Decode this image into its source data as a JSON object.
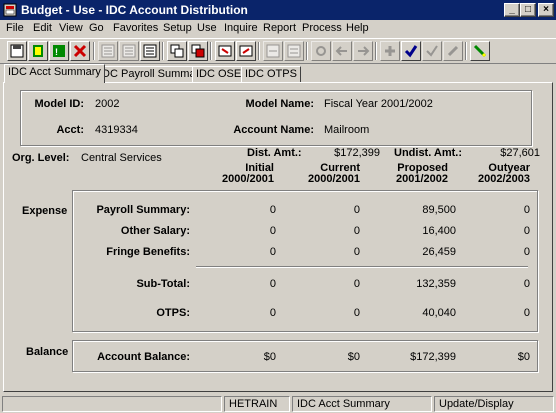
{
  "window": {
    "title": "Budget - Use - IDC Account Distribution"
  },
  "menu": [
    "File",
    "Edit",
    "View",
    "Go",
    "Favorites",
    "Setup",
    "Use",
    "Inquire",
    "Report",
    "Process",
    "Help"
  ],
  "tabs": [
    "IDC Acct Summary",
    "IDC Payroll Summary",
    "IDC OSE",
    "IDC OTPS"
  ],
  "header": {
    "model_id_label": "Model ID:",
    "model_id": "2002",
    "model_name_label": "Model Name:",
    "model_name": "Fiscal Year 2001/2002",
    "acct_label": "Acct:",
    "acct": "4319334",
    "account_name_label": "Account Name:",
    "account_name": "Mailroom"
  },
  "org": {
    "org_level_label": "Org. Level:",
    "org_level": "Central Services",
    "dist_amt_label": "Dist. Amt.:",
    "dist_amt": "$172,399",
    "undist_amt_label": "Undist. Amt.:",
    "undist_amt": "$27,601"
  },
  "columns": [
    {
      "line1": "Initial",
      "line2": "2000/2001"
    },
    {
      "line1": "Current",
      "line2": "2000/2001"
    },
    {
      "line1": "Proposed",
      "line2": "2001/2002"
    },
    {
      "line1": "Outyear",
      "line2": "2002/2003"
    }
  ],
  "expense": {
    "section_label": "Expense",
    "rows": [
      {
        "label": "Payroll Summary:",
        "values": [
          "0",
          "0",
          "89,500",
          "0"
        ]
      },
      {
        "label": "Other Salary:",
        "values": [
          "0",
          "0",
          "16,400",
          "0"
        ]
      },
      {
        "label": "Fringe Benefits:",
        "values": [
          "0",
          "0",
          "26,459",
          "0"
        ]
      }
    ],
    "subtotal": {
      "label": "Sub-Total:",
      "values": [
        "0",
        "0",
        "132,359",
        "0"
      ]
    },
    "otps": {
      "label": "OTPS:",
      "values": [
        "0",
        "0",
        "40,040",
        "0"
      ]
    }
  },
  "balance": {
    "section_label": "Balance",
    "row": {
      "label": "Account Balance:",
      "values": [
        "$0",
        "$0",
        "$172,399",
        "$0"
      ]
    }
  },
  "status": {
    "user": "HETRAIN",
    "page": "IDC Acct Summary",
    "mode": "Update/Display"
  }
}
